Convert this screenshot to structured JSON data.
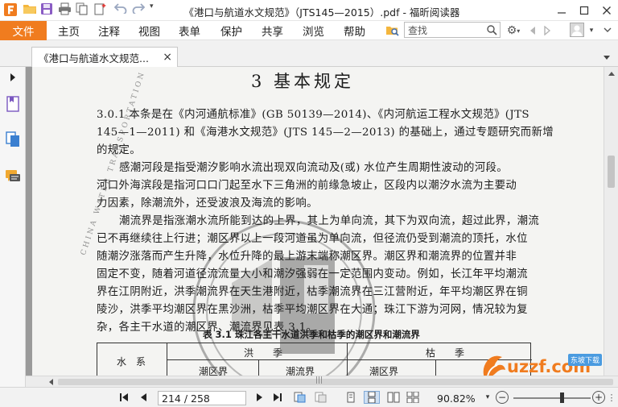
{
  "window": {
    "title": "《港口与航道水文规范》（JTS145—2015）.pdf - 福昕阅读器",
    "minimize_icon": "minimize-icon",
    "maximize_icon": "maximize-icon",
    "close_icon": "close-icon"
  },
  "quick_access": [
    "app-logo-icon",
    "open-icon",
    "save-icon",
    "print-icon",
    "copy-icon",
    "new-icon",
    "undo-icon",
    "redo-icon",
    "qat-dropdown-icon"
  ],
  "menu": {
    "file_label": "文件",
    "items": [
      "主页",
      "注释",
      "视图",
      "表单",
      "保护",
      "共享",
      "浏览",
      "帮助"
    ]
  },
  "search": {
    "placeholder": "查找",
    "value": "查找"
  },
  "tab": {
    "label": "《港口与航道水文规范...",
    "close_glyph": "×"
  },
  "document": {
    "chapter_heading": "3  基本规定",
    "lines": [
      "3.0.1    本条是在《内河通航标准》(GB 50139—2014)、《内河航运工程水文规范》(JTS",
      "145—1—2011) 和《海港水文规范》(JTS 145—2—2013) 的基础上，通过专题研究而新增",
      "的规定。",
      "感潮河段是指受潮汐影响水流出现双向流动及(或) 水位产生周期性波动的河段。",
      "河口外海滨段是指河口口门起至水下三角洲的前缘急坡止，区段内以潮汐水流为主要动",
      "力因素，除潮流外，还受波浪及海流的影响。",
      "潮流界是指涨潮水流所能到达的上界，其上为单向流，其下为双向流，超过此界，潮流",
      "已不再继续往上行进；潮区界以上一段河道虽为单向流，但径流仍受到潮流的顶托，水位",
      "随潮汐涨落而产生升降，水位升降的最上游末端称潮区界。潮区界和潮流界的位置并非",
      "固定不变，随着河道径流流量大小和潮汐强弱在一定范围内变动。例如，长江年平均潮流",
      "界在江阴附近，洪季潮流界在天生港附近，枯季潮流界在三江营附近，年平均潮区界在铜",
      "陵沙，洪季平均潮区界在黑沙洲，枯季平均潮区界在大通；珠江下游为河网，情况较为复",
      "杂，各主干水道的潮区界、潮流界见表 3.1。"
    ],
    "table_caption": "表 3.1   珠江各主干水道洪季和枯季的潮区界和潮流界",
    "table": {
      "col_water_system": "水　系",
      "flood_season": "洪　　季",
      "dry_season": "枯　　季",
      "sub_tidal_limit": "潮区界",
      "sub_current_limit": "潮流界",
      "sub_tidal_limit_2": "潮区界"
    },
    "watermark_text": "CHINA WATER TRANSPORTATION",
    "logo_text": "uzzf.com",
    "logo_badge": "东坡下载"
  },
  "status": {
    "page_value": "214 / 258",
    "zoom": "90.82%",
    "zoom_minus": "−",
    "zoom_plus": "+",
    "zoom_level": 0.62
  },
  "colors": {
    "accent": "#f07c1f",
    "page_bg": "#f4f4f2",
    "viewer_bg": "#9a9a9a"
  }
}
